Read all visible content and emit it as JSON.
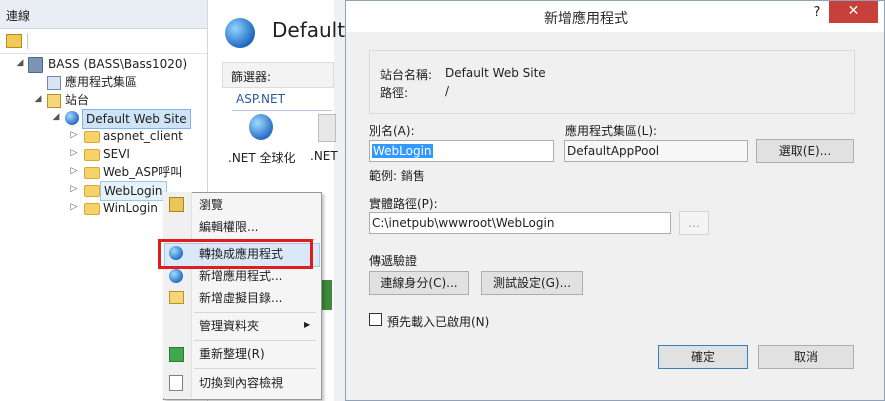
{
  "connections": {
    "title": "連線",
    "tree": {
      "server": "BASS (BASS\\Bass1020)",
      "app_pools": "應用程式集區",
      "sites": "站台",
      "default_site": "Default Web Site",
      "folders": [
        "aspnet_client",
        "SEVI",
        "Web_ASP呼叫",
        "WebLogin",
        "WinLogin"
      ]
    }
  },
  "features": {
    "title": "Default",
    "filter_label": "篩選器:",
    "group_label": "ASP.NET",
    "items": [
      ".NET 全球化",
      ".NET"
    ]
  },
  "context_menu": {
    "items": [
      {
        "label": "瀏覽",
        "icon": "browse-icon"
      },
      {
        "label": "編輯權限...",
        "icon": ""
      },
      {
        "label": "轉換成應用程式",
        "icon": "convert-app-icon"
      },
      {
        "label": "新增應用程式...",
        "icon": "add-app-icon"
      },
      {
        "label": "新增虛擬目錄...",
        "icon": "virtual-dir-icon"
      },
      {
        "label": "管理資料夾",
        "icon": "",
        "submenu": true
      },
      {
        "label": "重新整理(R)",
        "icon": "refresh-icon"
      },
      {
        "label": "切換到內容檢視",
        "icon": "content-view-icon"
      }
    ],
    "submenu_arrow": "▶"
  },
  "dialog": {
    "title": "新增應用程式",
    "help": "?",
    "close": "✕",
    "site_name_label": "站台名稱:",
    "site_name_value": "Default Web Site",
    "path_label": "路徑:",
    "path_value": "/",
    "alias_label": "別名(A):",
    "alias_value": "WebLogin",
    "app_pool_label": "應用程式集區(L):",
    "app_pool_value": "DefaultAppPool",
    "select_button": "選取(E)...",
    "example": "範例: 銷售",
    "physical_path_label": "實體路徑(P):",
    "physical_path_value": "C:\\inetpub\\wwwroot\\WebLogin",
    "browse_button": "...",
    "pass_through_label": "傳遞驗證",
    "connect_as_button": "連線身分(C)...",
    "test_settings_button": "測試設定(G)...",
    "preload_label": "預先載入已啟用(N)",
    "ok_button": "確定",
    "cancel_button": "取消"
  }
}
